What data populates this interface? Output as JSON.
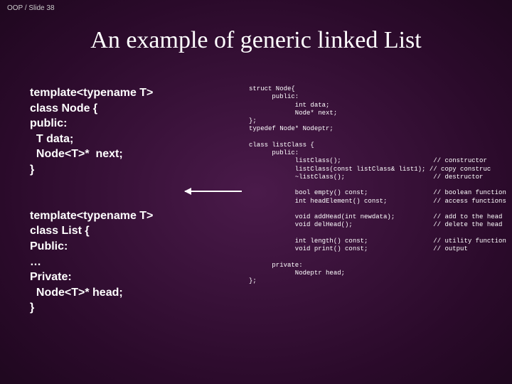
{
  "slide_label": "OOP / Slide 38",
  "title": "An example of  generic linked List",
  "left_code": "template<typename T>\nclass Node {\npublic:\n  T data;\n  Node<T>*  next;\n}\n\n\ntemplate<typename T>\nclass List {\nPublic:\n…\nPrivate:\n  Node<T>* head;\n}",
  "right_code": "struct Node{\n      public:\n            int data;\n            Node* next;\n};\ntypedef Node* Nodeptr;\n\nclass listClass {\n      public:\n            listClass();                        // constructor\n            listClass(const listClass& list1); // copy construc\n            ~listClass();                       // destructor\n\n            bool empty() const;                 // boolean function\n            int headElement() const;            // access functions\n\n            void addHead(int newdata);          // add to the head\n            void delHead();                     // delete the head\n\n            int length() const;                 // utility function\n            void print() const;                 // output\n\n      private:\n            Nodeptr head;\n};"
}
